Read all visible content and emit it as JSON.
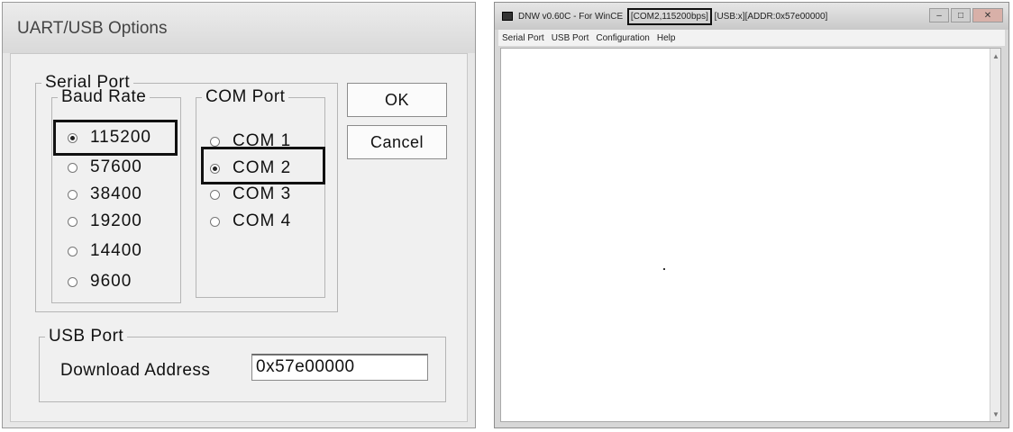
{
  "dialog": {
    "title": "UART/USB Options",
    "serial_group": "Serial Port",
    "baud_group": "Baud Rate",
    "baud_rates": [
      "115200",
      "57600",
      "38400",
      "19200",
      "14400",
      "9600"
    ],
    "baud_selected": "115200",
    "com_group": "COM Port",
    "com_ports": [
      "COM 1",
      "COM 2",
      "COM 3",
      "COM 4"
    ],
    "com_selected": "COM 2",
    "ok_label": "OK",
    "cancel_label": "Cancel",
    "usb_group": "USB Port",
    "download_label": "Download Address",
    "download_value": "0x57e00000"
  },
  "window": {
    "title_prefix": "DNW v0.60C - For WinCE",
    "title_com": "[COM2,115200bps]",
    "title_suffix": "[USB:x][ADDR:0x57e00000]",
    "menu": [
      "Serial Port",
      "USB Port",
      "Configuration",
      "Help"
    ]
  }
}
